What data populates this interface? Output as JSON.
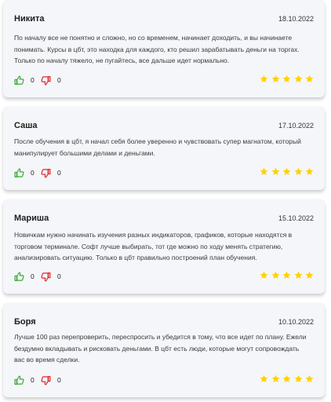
{
  "reviews": [
    {
      "name": "Никита",
      "date": "18.10.2022",
      "lines": [
        "По началу все не понятно и сложно, но со временем, начинает доходить, и вы начинаете",
        "понимать. Курсы в цбт, это находка для каждого, кто решил зарабатывать деньги на торгах.",
        "Только по началу тяжело, не пугайтесь, все дальше идет нормально."
      ],
      "likes": "0",
      "dislikes": "0",
      "rating": 5
    },
    {
      "name": "Саша",
      "date": "17.10.2022",
      "lines": [
        "После обучения в цбт, я начал себя более уверенно и чувствовать супер магнатом, который",
        "манипулирует большими делами и деньгами."
      ],
      "likes": "0",
      "dislikes": "0",
      "rating": 5
    },
    {
      "name": "Мариша",
      "date": "15.10.2022",
      "lines": [
        "Новичкам нужно начинать изучения разных индикаторов, графиков, которые находятся в",
        "торговом терминале. Софт лучше выбирать, тот где можно по ходу менять стратегию,",
        "анализировать ситуацию. Только в цбт правильно построений план обучения."
      ],
      "likes": "0",
      "dislikes": "0",
      "rating": 5
    },
    {
      "name": "Боря",
      "date": "10.10.2022",
      "lines": [
        "Лучше 100 раз перепроверить, переспросить и убедится в тому, что все идет по плану. Ежели",
        "бездумно вкладывать и рисковать деньгами. В цбт есть люди, которые могут сопровождать",
        "вас во время сделки."
      ],
      "likes": "0",
      "dislikes": "0",
      "rating": 5
    }
  ],
  "icons": {
    "like": "thumbs-up-icon",
    "dislike": "thumbs-down-icon",
    "star": "star-icon"
  },
  "colors": {
    "like": "#3aa935",
    "dislike": "#e0262b",
    "star": "#ffd200",
    "card_bg": "#f4f6f9"
  }
}
